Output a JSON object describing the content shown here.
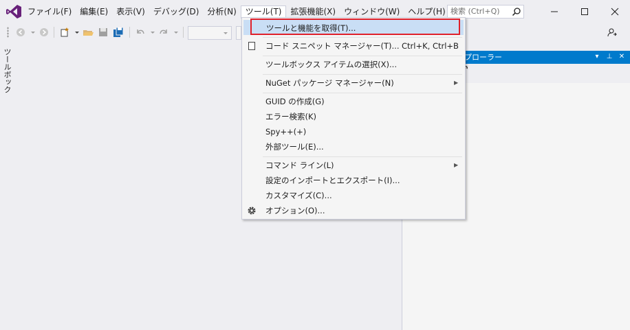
{
  "menu": {
    "items": [
      {
        "label": "ファイル(F)"
      },
      {
        "label": "編集(E)"
      },
      {
        "label": "表示(V)"
      },
      {
        "label": "デバッグ(D)"
      },
      {
        "label": "分析(N)"
      },
      {
        "label": "ツール(T)"
      },
      {
        "label": "拡張機能(X)"
      },
      {
        "label": "ウィンドウ(W)"
      },
      {
        "label": "ヘルプ(H)"
      }
    ]
  },
  "search": {
    "placeholder": "検索 (Ctrl+Q)",
    "icon": "search-icon"
  },
  "toolbox": {
    "label": "ツールボックス"
  },
  "panel": {
    "header": "プローラー"
  },
  "tools_menu": {
    "items": [
      {
        "label": "ツールと機能を取得(T)...",
        "highlighted": true
      },
      {
        "label": "コード スニペット マネージャー(T)...",
        "shortcut": "Ctrl+K, Ctrl+B",
        "icon": "checkbox-icon"
      },
      {
        "label": "ツールボックス アイテムの選択(X)..."
      },
      {
        "label": "NuGet パッケージ マネージャー(N)",
        "submenu": true
      },
      {
        "label": "GUID の作成(G)"
      },
      {
        "label": "エラー検索(K)"
      },
      {
        "label": "Spy++(+)"
      },
      {
        "label": "外部ツール(E)..."
      },
      {
        "label": "コマンド ライン(L)",
        "submenu": true
      },
      {
        "label": "設定のインポートとエクスポート(I)..."
      },
      {
        "label": "カスタマイズ(C)..."
      },
      {
        "label": "オプション(O)...",
        "icon": "gear-icon"
      }
    ]
  },
  "colors": {
    "accent": "#007acc",
    "highlight_border": "#e0202a",
    "selection": "#c9def5",
    "logo": "#68217a"
  }
}
